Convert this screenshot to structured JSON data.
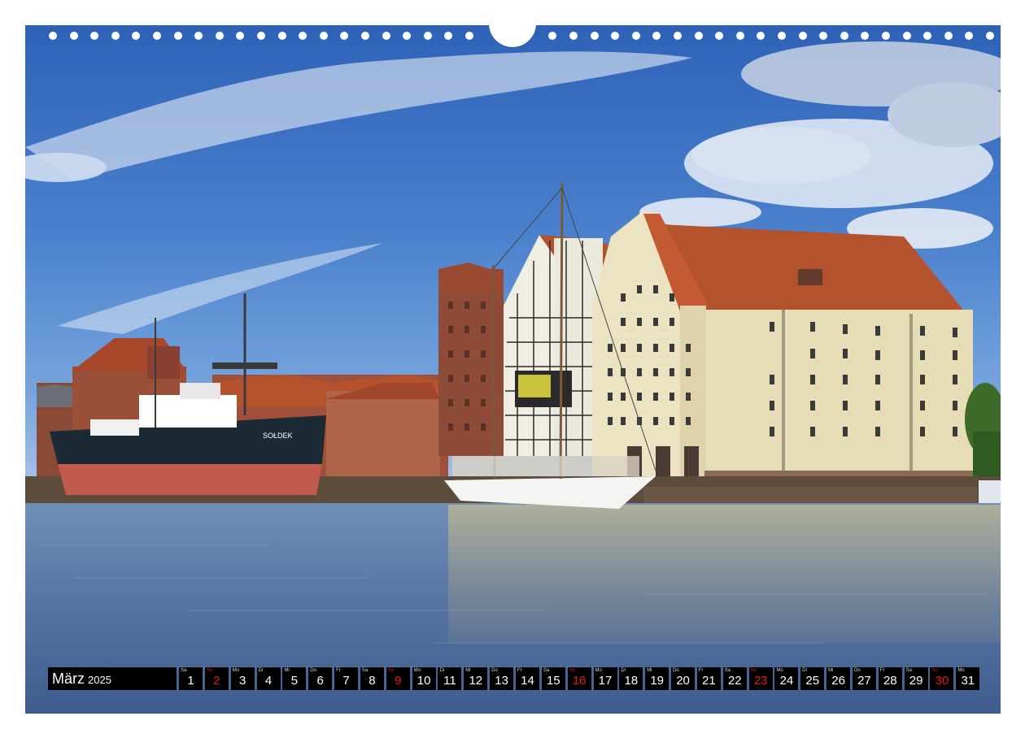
{
  "calendar": {
    "month": "März",
    "year": "2025",
    "days": [
      {
        "wd": "Sa",
        "num": "1",
        "sunday": false
      },
      {
        "wd": "So",
        "num": "2",
        "sunday": true
      },
      {
        "wd": "Mo",
        "num": "3",
        "sunday": false
      },
      {
        "wd": "Di",
        "num": "4",
        "sunday": false
      },
      {
        "wd": "Mi",
        "num": "5",
        "sunday": false
      },
      {
        "wd": "Do",
        "num": "6",
        "sunday": false
      },
      {
        "wd": "Fr",
        "num": "7",
        "sunday": false
      },
      {
        "wd": "Sa",
        "num": "8",
        "sunday": false
      },
      {
        "wd": "So",
        "num": "9",
        "sunday": true
      },
      {
        "wd": "Mo",
        "num": "10",
        "sunday": false
      },
      {
        "wd": "Di",
        "num": "11",
        "sunday": false
      },
      {
        "wd": "Mi",
        "num": "12",
        "sunday": false
      },
      {
        "wd": "Do",
        "num": "13",
        "sunday": false
      },
      {
        "wd": "Fr",
        "num": "14",
        "sunday": false
      },
      {
        "wd": "Sa",
        "num": "15",
        "sunday": false
      },
      {
        "wd": "So",
        "num": "16",
        "sunday": true
      },
      {
        "wd": "Mo",
        "num": "17",
        "sunday": false
      },
      {
        "wd": "Di",
        "num": "18",
        "sunday": false
      },
      {
        "wd": "Mi",
        "num": "19",
        "sunday": false
      },
      {
        "wd": "Do",
        "num": "20",
        "sunday": false
      },
      {
        "wd": "Fr",
        "num": "21",
        "sunday": false
      },
      {
        "wd": "Sa",
        "num": "22",
        "sunday": false
      },
      {
        "wd": "So",
        "num": "23",
        "sunday": true
      },
      {
        "wd": "Mo",
        "num": "24",
        "sunday": false
      },
      {
        "wd": "Di",
        "num": "25",
        "sunday": false
      },
      {
        "wd": "Mi",
        "num": "26",
        "sunday": false
      },
      {
        "wd": "Do",
        "num": "27",
        "sunday": false
      },
      {
        "wd": "Fr",
        "num": "28",
        "sunday": false
      },
      {
        "wd": "Sa",
        "num": "29",
        "sunday": false
      },
      {
        "wd": "So",
        "num": "30",
        "sunday": true
      },
      {
        "wd": "Mo",
        "num": "31",
        "sunday": false
      }
    ]
  },
  "photo": {
    "ship_name": "SOŁDEK",
    "colors": {
      "sky": "#3b6fc2",
      "water": "#5a7aa8",
      "building_cream": "#ece3c2",
      "roof": "#b4522e",
      "brick": "#8a4a36",
      "ship_hull": "#1c2a36",
      "ship_bottom": "#c25a4e"
    }
  }
}
